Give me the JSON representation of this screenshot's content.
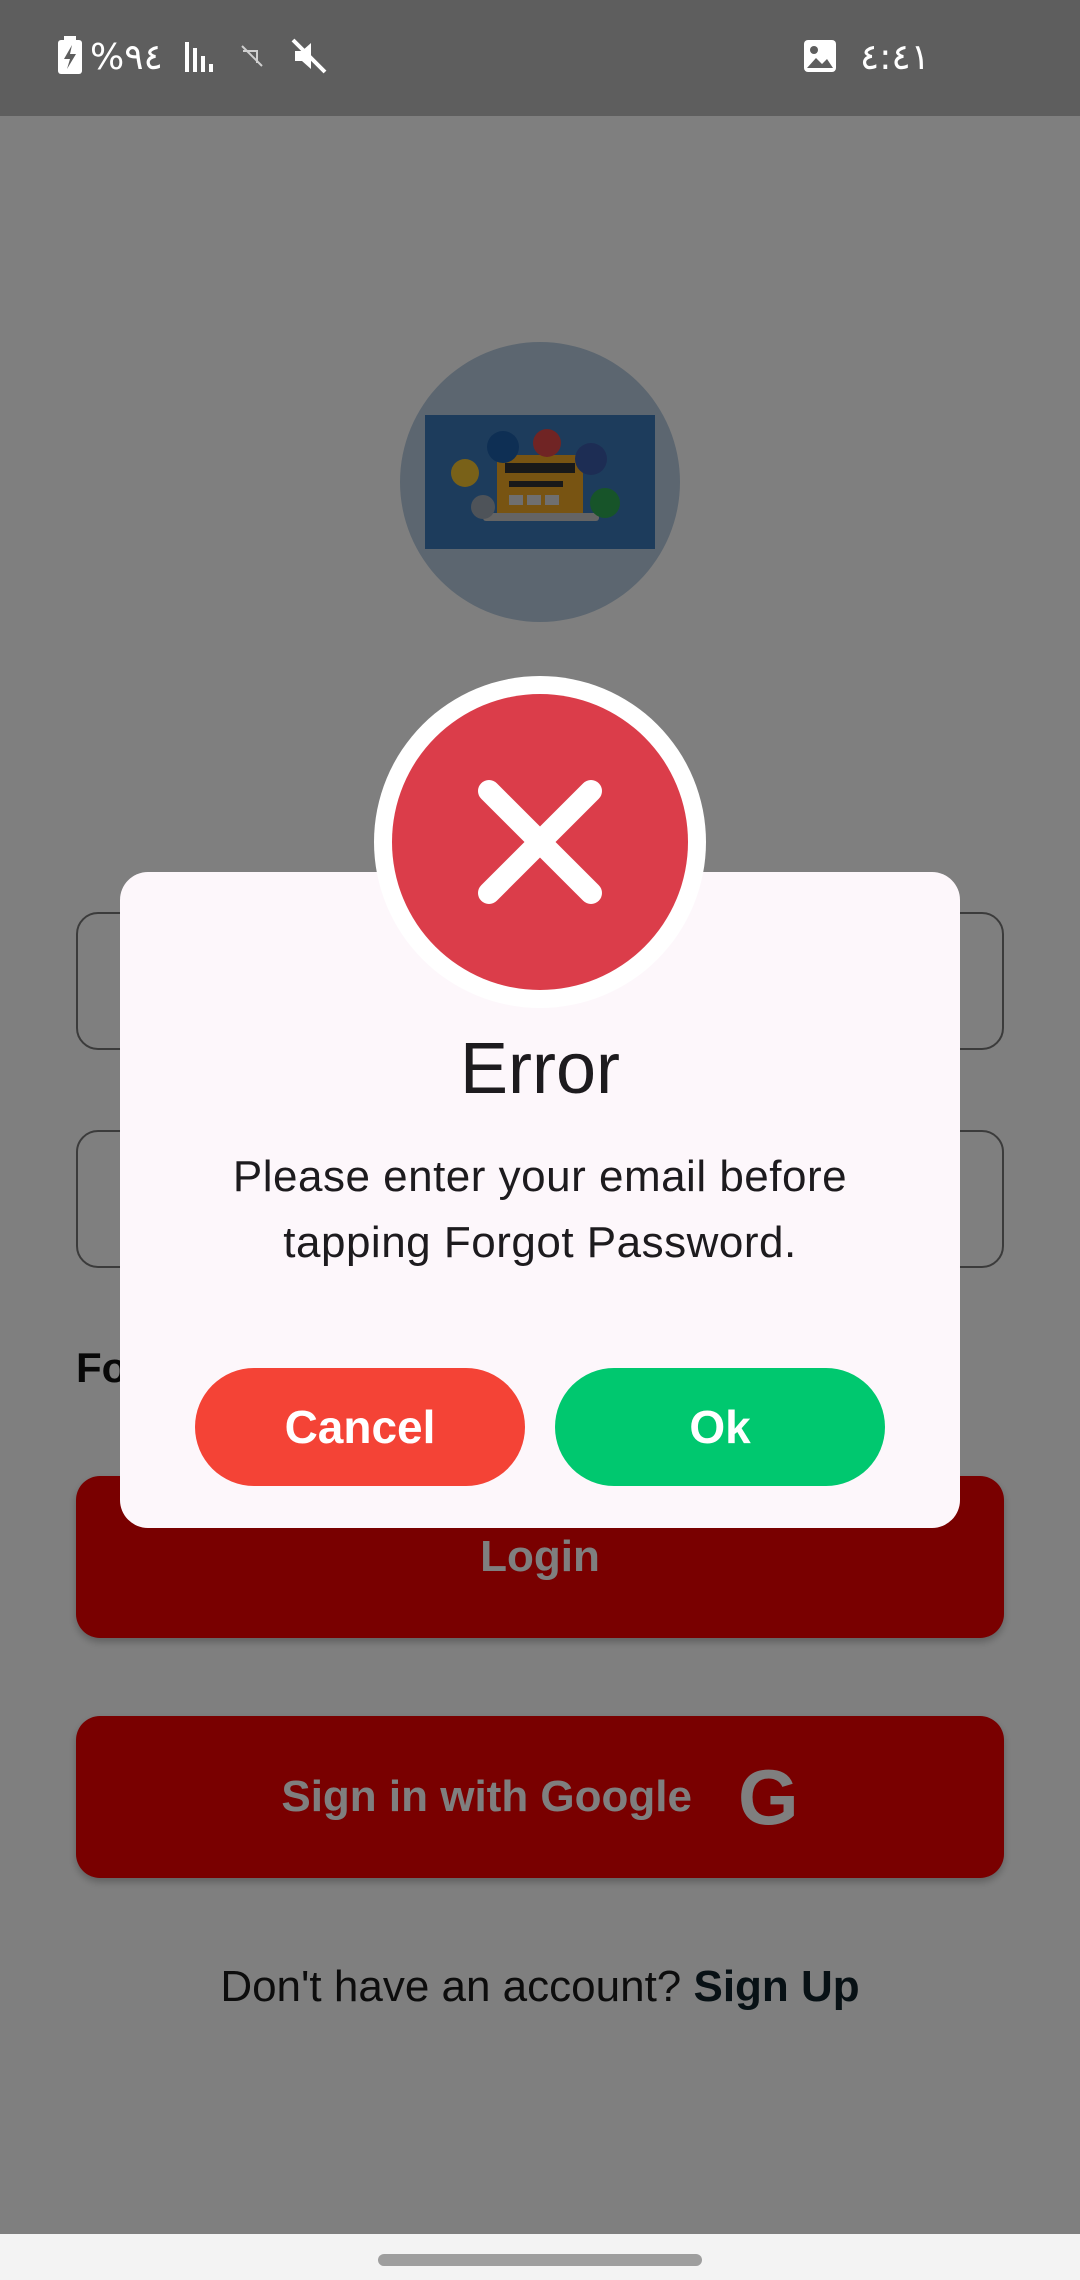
{
  "status_bar": {
    "battery_percent": "%٩٤",
    "time": "٤:٤١",
    "icons": [
      "battery-charging-icon",
      "signal-icon",
      "no-sim-icon",
      "mute-icon",
      "gallery-notification-icon"
    ]
  },
  "login_page": {
    "forgot_label": "Fo",
    "login_button": "Login",
    "google_button": "Sign in with Google",
    "google_icon": "G",
    "signup_prompt": "Don't have an account? ",
    "signup_link": "Sign Up"
  },
  "dialog": {
    "title": "Error",
    "message": "Please enter your email before tapping Forgot Password.",
    "cancel_label": "Cancel",
    "ok_label": "Ok",
    "icon": "error-x-icon"
  },
  "colors": {
    "error_red": "#db3d4a",
    "cancel_red": "#f44336",
    "ok_green": "#00c86f",
    "primary_red": "#f20000"
  }
}
